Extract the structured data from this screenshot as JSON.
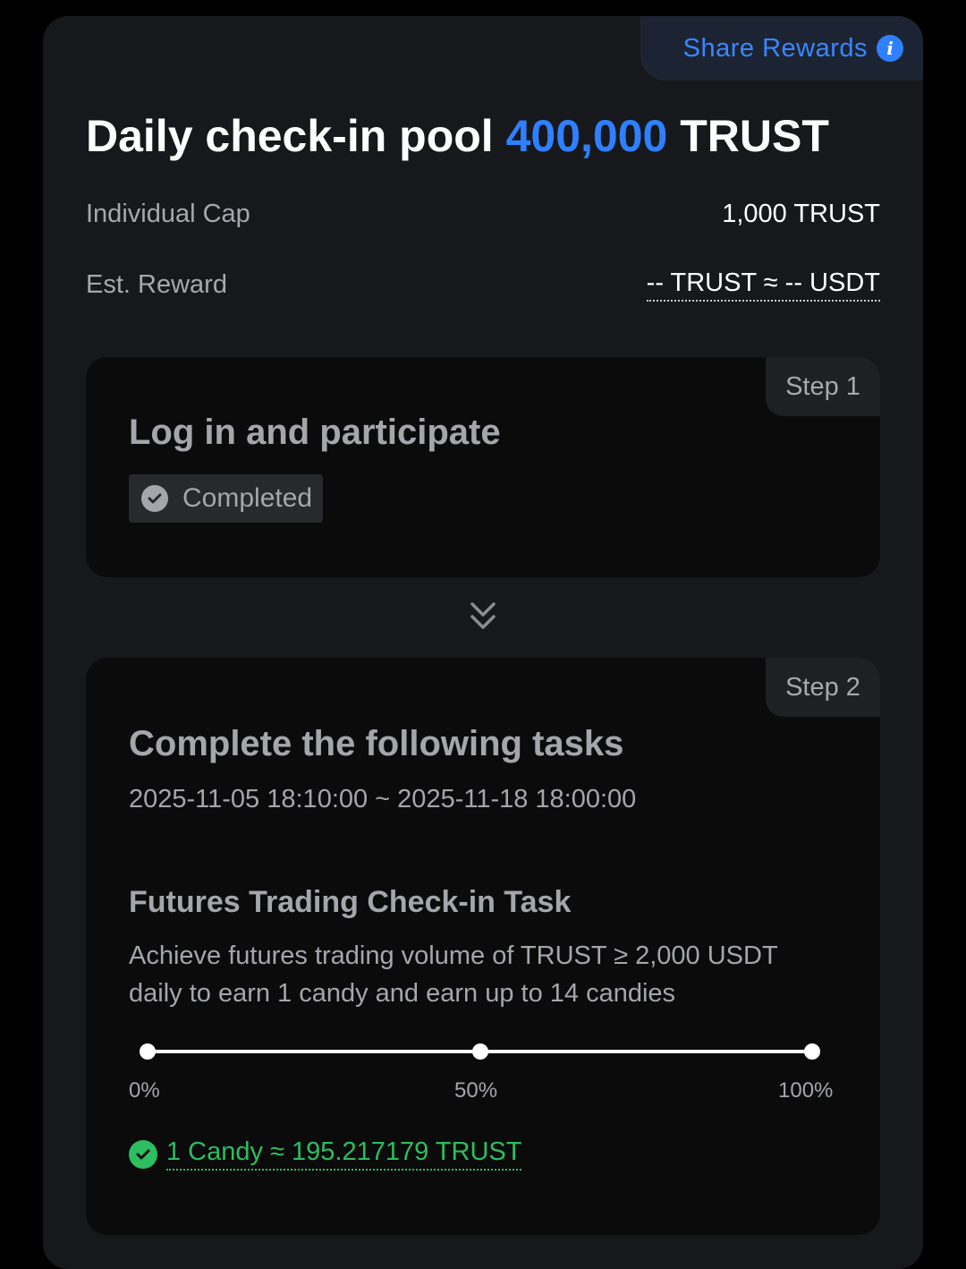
{
  "share": {
    "label": "Share Rewards",
    "icon": "info-icon"
  },
  "pool": {
    "title_prefix": "Daily check-in pool",
    "amount": "400,000",
    "token": "TRUST"
  },
  "rows": {
    "cap_label": "Individual Cap",
    "cap_value": "1,000 TRUST",
    "reward_label": "Est. Reward",
    "reward_value": "-- TRUST ≈ -- USDT"
  },
  "step1": {
    "tag": "Step 1",
    "title": "Log in and participate",
    "status": "Completed"
  },
  "step2": {
    "tag": "Step 2",
    "title": "Complete the following tasks",
    "dates": "2025-11-05 18:10:00 ~ 2025-11-18 18:00:00",
    "task_title": "Futures Trading Check-in Task",
    "task_desc": "Achieve futures trading volume of TRUST ≥ 2,000 USDT daily to earn 1 candy and earn up to 14 candies",
    "progress_labels": [
      "0%",
      "50%",
      "100%"
    ],
    "reward": "1 Candy ≈ 195.217179 TRUST"
  },
  "colors": {
    "accent": "#2f80ff",
    "success": "#2ebd5f",
    "card_bg": "#17181b",
    "step_bg": "#0b0b0c"
  }
}
